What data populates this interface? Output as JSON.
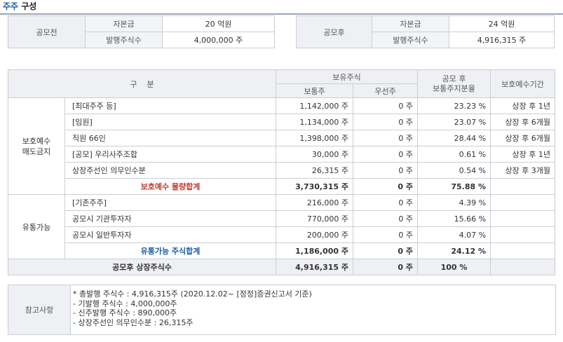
{
  "title": {
    "highlight": "주주",
    "rest": " 구성"
  },
  "before": {
    "label": "공모전",
    "rows": [
      {
        "name": "자본금",
        "value": "20 억원"
      },
      {
        "name": "발행주식수",
        "value": "4,000,000 주"
      }
    ]
  },
  "after": {
    "label": "공모후",
    "rows": [
      {
        "name": "자본금",
        "value": "24 억원"
      },
      {
        "name": "발행주식수",
        "value": "4,916,315 주"
      }
    ]
  },
  "main": {
    "headers": {
      "gubun": "구    분",
      "holding": "보유주식",
      "common": "보통주",
      "preferred": "우선주",
      "ratio": "공모 후\n보통주지분율",
      "lockup": "보호예수기간"
    },
    "group1": {
      "label": "보호예수\n매도금지",
      "rows": [
        {
          "name": "[최대주주 등]",
          "common": "1,142,000 주",
          "preferred": "0 주",
          "ratio": "23.23 %",
          "lockup": "상장 후 1년"
        },
        {
          "name": "[임원]",
          "common": "1,134,000 주",
          "preferred": "0 주",
          "ratio": "23.07 %",
          "lockup": "상장 후 6개월"
        },
        {
          "name": "직원 66인",
          "common": "1,398,000 주",
          "preferred": "0 주",
          "ratio": "28.44 %",
          "lockup": "상장 후 6개월"
        },
        {
          "name": "[공모] 우리사주조합",
          "common": "30,000 주",
          "preferred": "0 주",
          "ratio": "0.61 %",
          "lockup": "상장 후 1년"
        },
        {
          "name": "상장주선인 의무인수분",
          "common": "26,315 주",
          "preferred": "0 주",
          "ratio": "0.54 %",
          "lockup": "상장 후 3개월"
        }
      ],
      "total": {
        "name": "보호예수 물량합계",
        "common": "3,730,315 주",
        "preferred": "0 주",
        "ratio": "75.88 %"
      }
    },
    "group2": {
      "label": "유통가능",
      "rows": [
        {
          "name": "[기존주주]",
          "common": "216,000 주",
          "preferred": "0 주",
          "ratio": "4.39 %"
        },
        {
          "name": "공모시 기관투자자",
          "common": "770,000 주",
          "preferred": "0 주",
          "ratio": "15.66 %"
        },
        {
          "name": "공모시 일반투자자",
          "common": "200,000 주",
          "preferred": "0 주",
          "ratio": "4.07 %"
        }
      ],
      "total": {
        "name": "유통가능 주식합계",
        "common": "1,186,000 주",
        "preferred": "0 주",
        "ratio": "24.12 %"
      }
    },
    "grand": {
      "name": "공모후 상장주식수",
      "common": "4,916,315 주",
      "preferred": "0 주",
      "ratio": "100 %"
    }
  },
  "notes": {
    "label": "참고사항",
    "lines": [
      "* 총발행 주식수 : 4,916,315주 (2020.12.02~ [정정]증권신고서 기준)",
      "- 기발행 주식수 : 4,000,000주",
      "- 신주발행 주식수 : 890,000주",
      "- 상장주선인 의무인수분 : 26,315주"
    ]
  }
}
